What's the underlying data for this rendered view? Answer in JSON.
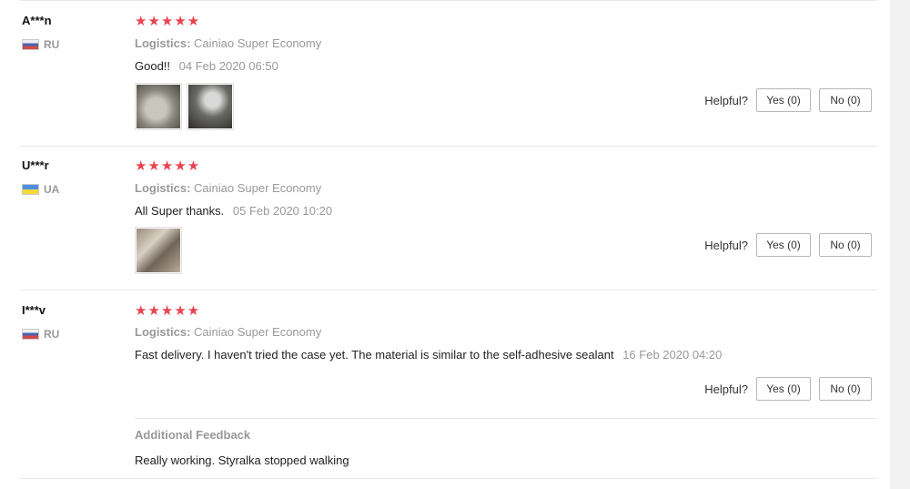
{
  "reviews": [
    {
      "user": "A***n",
      "country": "RU",
      "flag": "ru",
      "rating": "★★★★★",
      "logistics_label": "Logistics:",
      "logistics_value": "Cainiao Super Economy",
      "text": "Good!!",
      "date": "04 Feb 2020 06:50",
      "photos": [
        "photo-1",
        "photo-2"
      ],
      "helpful_label": "Helpful?",
      "yes_label": "Yes (0)",
      "no_label": "No (0)"
    },
    {
      "user": "U***r",
      "country": "UA",
      "flag": "ua",
      "rating": "★★★★★",
      "logistics_label": "Logistics:",
      "logistics_value": "Cainiao Super Economy",
      "text": "All Super thanks.",
      "date": "05 Feb 2020 10:20",
      "photos": [
        "photo-1"
      ],
      "helpful_label": "Helpful?",
      "yes_label": "Yes (0)",
      "no_label": "No (0)"
    },
    {
      "user": "I***v",
      "country": "RU",
      "flag": "ru",
      "rating": "★★★★★",
      "logistics_label": "Logistics:",
      "logistics_value": "Cainiao Super Economy",
      "text": "Fast delivery. I haven't tried the case yet. The material is similar to the self-adhesive sealant",
      "date": "16 Feb 2020 04:20",
      "helpful_label": "Helpful?",
      "yes_label": "Yes (0)",
      "no_label": "No (0)",
      "additional_title": "Additional Feedback",
      "additional_text": "Really working. Styralka stopped walking"
    }
  ],
  "colors": {
    "star": "#e8434f",
    "muted": "#999999",
    "border": "#e8e8e8"
  }
}
